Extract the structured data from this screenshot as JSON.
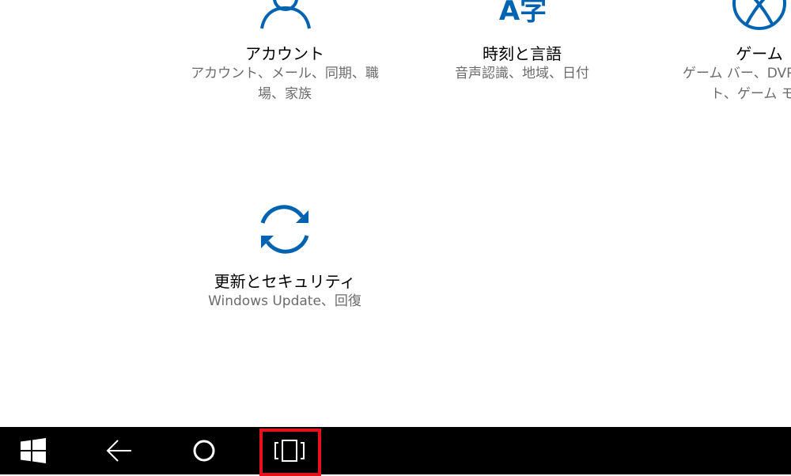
{
  "colors": {
    "accent": "#0063B1",
    "title_text": "#000000",
    "desc_text": "#6b6b6b",
    "taskbar_bg": "#000000",
    "highlight": "#E8101A"
  },
  "settings": {
    "tiles": [
      {
        "icon": "person-icon",
        "title": "アカウント",
        "desc_line1": "アカウント、メール、同期、職",
        "desc_line2": "場、家族"
      },
      {
        "icon": "language-icon",
        "icon_text": "A字",
        "title": "時刻と言語",
        "desc_line1": "音声認識、地域、日付",
        "desc_line2": ""
      },
      {
        "icon": "xbox-icon",
        "title": "ゲーム",
        "desc_line1": "ゲーム バー、DVR、ブロ",
        "desc_line2": "ト、ゲーム モー"
      },
      {
        "icon": "sync-icon",
        "title": "更新とセキュリティ",
        "desc_line1": "Windows Update、回復",
        "desc_line2": ""
      }
    ]
  },
  "taskbar": {
    "buttons": [
      {
        "icon": "windows-start-icon"
      },
      {
        "icon": "back-arrow-icon"
      },
      {
        "icon": "cortana-search-icon"
      },
      {
        "icon": "task-view-icon",
        "highlighted": true
      }
    ]
  }
}
